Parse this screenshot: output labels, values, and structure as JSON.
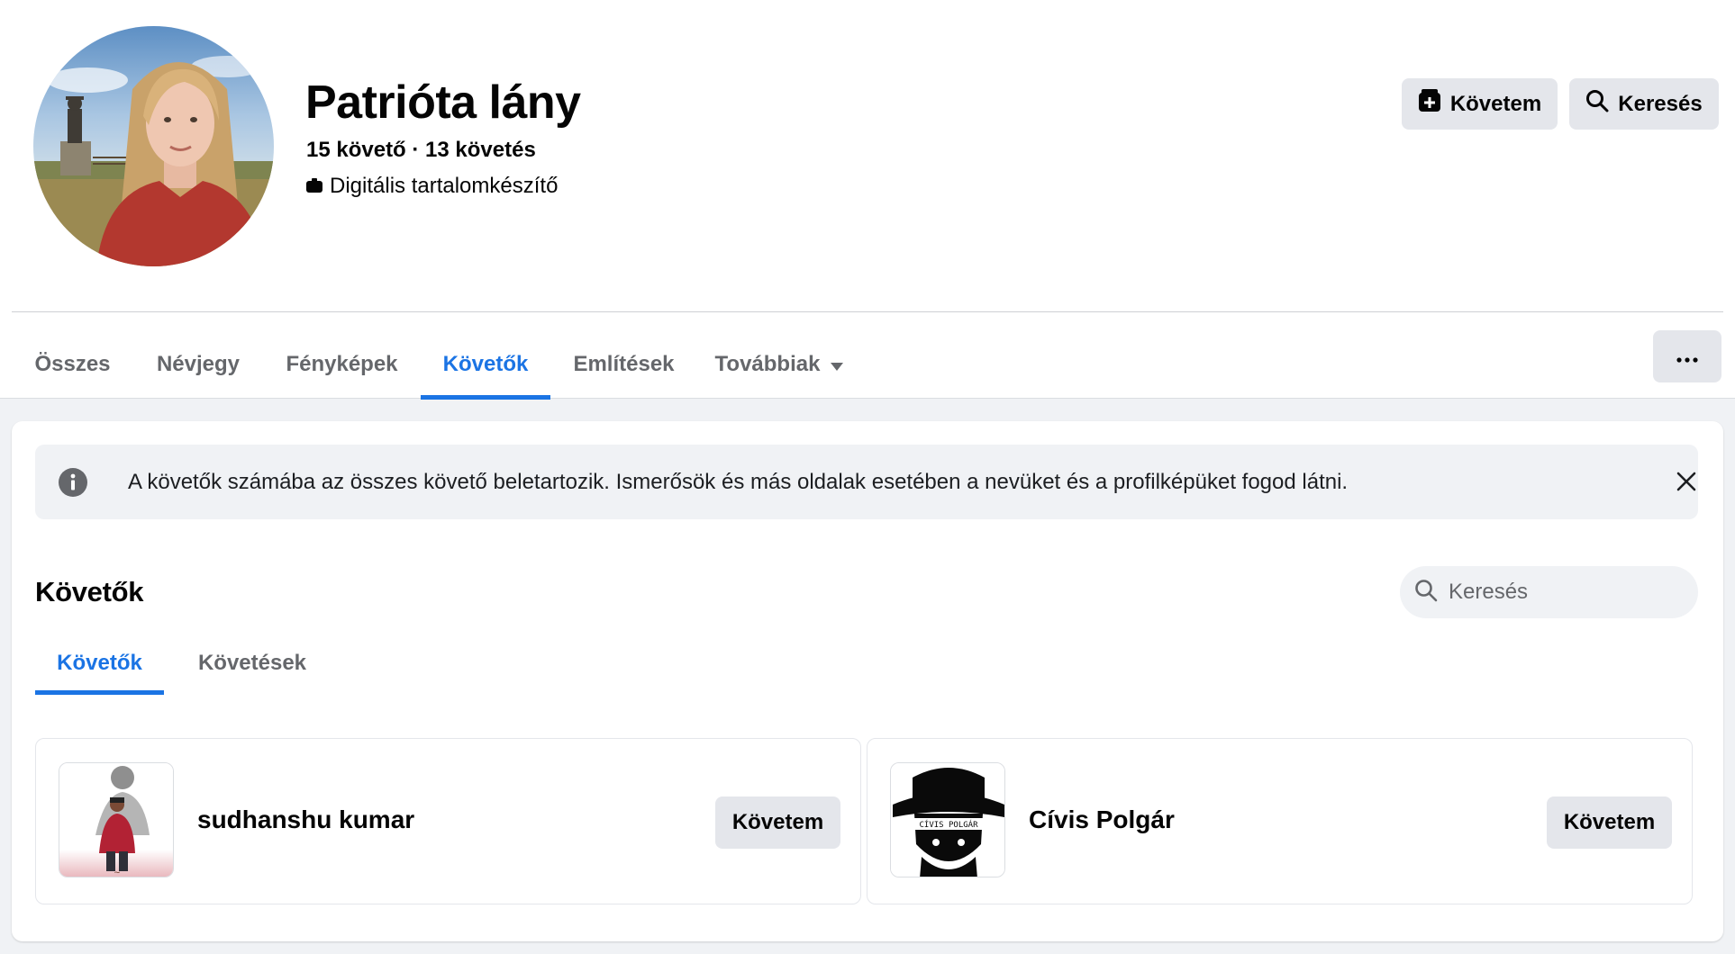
{
  "profile": {
    "name": "Patrióta lány",
    "stats": "15 követő · 13 követés",
    "category": "Digitális tartalomkészítő"
  },
  "header_actions": {
    "follow_label": "Követem",
    "search_label": "Keresés"
  },
  "nav": {
    "tabs": [
      {
        "label": "Összes"
      },
      {
        "label": "Névjegy"
      },
      {
        "label": "Fényképek"
      },
      {
        "label": "Követők"
      },
      {
        "label": "Említések"
      },
      {
        "label": "Továbbiak"
      }
    ],
    "active_tab": "Követők"
  },
  "info_banner": {
    "text": "A követők számába az összes követő beletartozik. Ismerősök és más oldalak esetében a nevüket és a profilképüket fogod látni."
  },
  "followers_section": {
    "title": "Követők",
    "search_placeholder": "Keresés",
    "tabs": [
      {
        "label": "Követők"
      },
      {
        "label": "Követések"
      }
    ],
    "active_tab": "Követők",
    "items": [
      {
        "name": "sudhanshu kumar",
        "button_label": "Követem"
      },
      {
        "name": "Cívis Polgár",
        "button_label": "Követem",
        "thumb_text": "CÍVIS POLGÁR"
      }
    ]
  },
  "colors": {
    "accent": "#1b74e4",
    "background": "#f0f2f5",
    "button_gray": "#e4e6eb",
    "secondary_text": "#65676b"
  }
}
